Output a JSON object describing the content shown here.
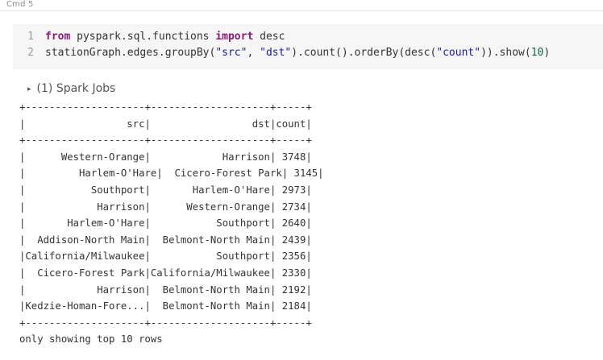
{
  "cell": {
    "label": "Cmd 5"
  },
  "code": {
    "lines": [
      {
        "number": "1",
        "keyword_from": "from",
        "module": " pyspark.sql.functions ",
        "keyword_import": "import",
        "name": " desc"
      },
      {
        "number": "2",
        "prefix": "stationGraph.edges.groupBy(",
        "arg1": "\"src\"",
        "comma": ", ",
        "arg2": "\"dst\"",
        "middle": ").count().orderBy(desc(",
        "arg3": "\"count\"",
        "before_num": ")).show(",
        "num": "10",
        "suffix": ")"
      }
    ]
  },
  "spark_jobs": {
    "caret": "▸",
    "label": "(1) Spark Jobs"
  },
  "output": {
    "border": "+--------------------+--------------------+-----+",
    "header": "|                 src|                 dst|count|",
    "rows": [
      "|      Western-Orange|            Harrison| 3748|",
      "|         Harlem-O'Hare|  Cicero-Forest Park| 3145|",
      "|           Southport|       Harlem-O'Hare| 2973|",
      "|            Harrison|      Western-Orange| 2734|",
      "|       Harlem-O'Hare|           Southport| 2640|",
      "|  Addison-North Main|  Belmont-North Main| 2439|",
      "|California/Milwaukee|           Southport| 2356|",
      "|  Cicero-Forest Park|California/Milwaukee| 2330|",
      "|            Harrison|  Belmont-North Main| 2192|",
      "|Kedzie-Homan-Fore...|  Belmont-North Main| 2184|"
    ],
    "footer": "only showing top 10 rows"
  }
}
